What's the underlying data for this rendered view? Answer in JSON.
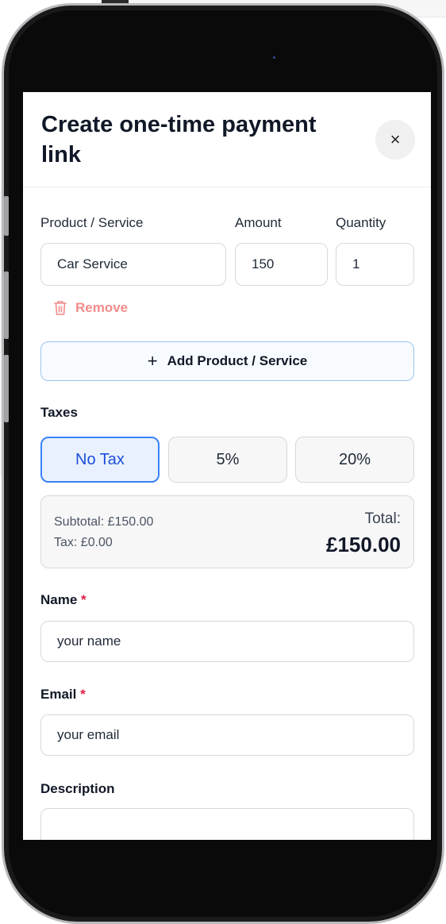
{
  "modal": {
    "title": "Create one-time payment link",
    "close_symbol": "×"
  },
  "line_item": {
    "product_label": "Product / Service",
    "amount_label": "Amount",
    "quantity_label": "Quantity",
    "product_value": "Car Service",
    "amount_value": "150",
    "quantity_value": "1",
    "remove_label": "Remove"
  },
  "add_product": {
    "plus": "+",
    "label": "Add Product / Service"
  },
  "taxes": {
    "label": "Taxes",
    "options": [
      "No Tax",
      "5%",
      "20%"
    ],
    "selected": "No Tax"
  },
  "summary": {
    "subtotal": "Subtotal: £150.00",
    "tax": "Tax: £0.00",
    "total_label": "Total:",
    "total_value": "£150.00"
  },
  "form": {
    "name_label": "Name",
    "name_placeholder": "your name",
    "email_label": "Email",
    "email_placeholder": "your email",
    "description_label": "Description",
    "required_marker": "*"
  },
  "colors": {
    "accent": "#3b82f6",
    "remove": "#f28b8b",
    "required": "#e11d48"
  }
}
